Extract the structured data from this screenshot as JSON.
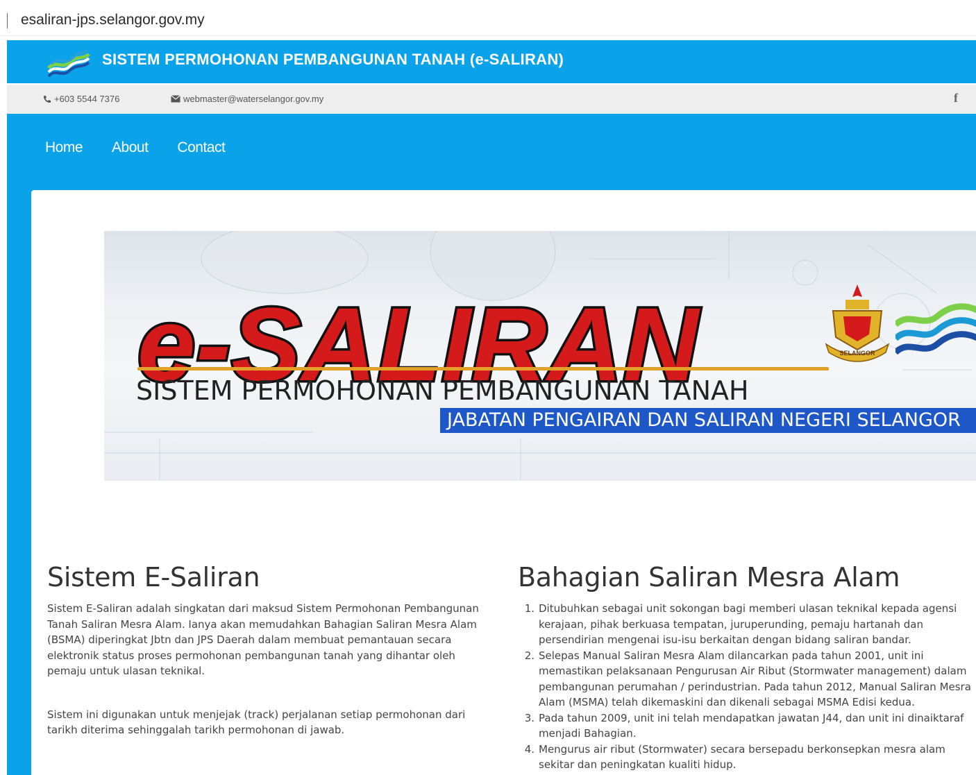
{
  "browser": {
    "url": "esaliran-jps.selangor.gov.my"
  },
  "header": {
    "title": "SISTEM PERMOHONAN PEMBANGUNAN TANAH (e-SALIRAN)"
  },
  "contact": {
    "phone": "+603 5544 7376",
    "email": "webmaster@waterselangor.gov.my",
    "social_icon": "facebook-icon"
  },
  "nav": {
    "items": [
      {
        "label": "Home"
      },
      {
        "label": "About"
      },
      {
        "label": "Contact"
      }
    ]
  },
  "banner": {
    "logo_text": "e-SALIRAN",
    "subtitle": "SISTEM PERMOHONAN PEMBANGUNAN TANAH",
    "department": "JABATAN PENGAIRAN DAN SALIRAN NEGERI SELANGOR",
    "crest_label": "SELANGOR"
  },
  "left_section": {
    "heading": "Sistem E-Saliran",
    "paragraph1": "Sistem E-Saliran adalah singkatan dari maksud Sistem Permohonan Pembangunan Tanah Saliran Mesra Alam. Ianya akan memudahkan Bahagian Saliran Mesra Alam (BSMA) diperingkat Jbtn dan JPS Daerah dalam membuat pemantauan secara elektronik status proses permohonan pembangunan tanah yang dihantar oleh pemaju untuk ulasan teknikal.",
    "paragraph2": "Sistem ini digunakan untuk menjejak (track) perjalanan setiap permohonan dari tarikh diterima sehinggalah tarikh permohonan di jawab."
  },
  "right_section": {
    "heading": "Bahagian Saliran Mesra Alam",
    "items": [
      {
        "num": "1.",
        "text": "Ditubuhkan sebagai unit sokongan bagi memberi ulasan teknikal kepada agensi kerajaan, pihak berkuasa tempatan, juruperunding, pemaju hartanah dan persendirian mengenai isu-isu berkaitan dengan bidang saliran bandar."
      },
      {
        "num": "2.",
        "text": "Selepas Manual Saliran Mesra Alam dilancarkan pada tahun 2001, unit ini memastikan pelaksanaan Pengurusan Air Ribut (Stormwater management) dalam pembangunan perumahan / perindustrian. Pada tahun 2012, Manual Saliran Mesra Alam (MSMA) telah dikemaskini dan dikenali sebagai MSMA Edisi kedua."
      },
      {
        "num": "3.",
        "text": "Pada tahun 2009, unit ini telah mendapatkan jawatan J44, dan unit ini dinaiktaraf menjadi Bahagian."
      },
      {
        "num": "4.",
        "text": "Mengurus air ribut (Stormwater) secara bersepadu berkonsepkan mesra alam sekitar dan peningkatan kualiti hidup."
      }
    ]
  },
  "colors": {
    "primary_blue": "#0aa3ea",
    "banner_red": "#d41a1a",
    "banner_blue": "#1e57c8",
    "accent_gold": "#e1a12a"
  }
}
